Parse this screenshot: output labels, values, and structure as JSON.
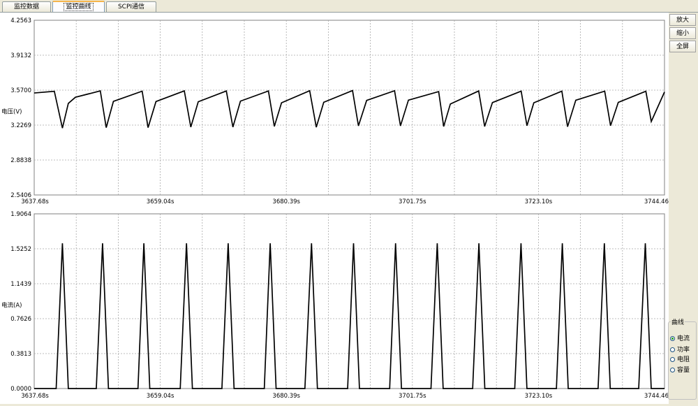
{
  "tabs": [
    {
      "label": "监控数据",
      "active": false
    },
    {
      "label": "监控曲线",
      "active": true
    },
    {
      "label": "SCPI通信",
      "active": false
    }
  ],
  "side_buttons": [
    "放大",
    "缩小",
    "全屏"
  ],
  "curve_group": {
    "title": "曲线",
    "options": [
      {
        "label": "电流",
        "selected": true
      },
      {
        "label": "功率",
        "selected": false
      },
      {
        "label": "电阻",
        "selected": false
      },
      {
        "label": "容量",
        "selected": false
      }
    ]
  },
  "chart_data": [
    {
      "type": "line",
      "ylabel": "电压(V)",
      "xlabel": "",
      "ylim": [
        2.5406,
        4.2563
      ],
      "yticks": [
        "4.2563",
        "3.9132",
        "3.5700",
        "3.2269",
        "2.8838",
        "2.5406"
      ],
      "xlim": [
        3637.68,
        3744.46
      ],
      "xticks": [
        "3637.68s",
        "3659.04s",
        "3680.39s",
        "3701.75s",
        "3723.10s",
        "3744.46"
      ],
      "grid": true,
      "series": [
        {
          "x": [
            3637.68,
            3641.09,
            3642.46,
            3643.46,
            3644.66,
            3648.88,
            3649.88,
            3651.1,
            3655.97,
            3656.97,
            3658.31,
            3663.11,
            3664.21,
            3665.47,
            3670.23,
            3671.34,
            3672.62,
            3677.36,
            3678.36,
            3679.58,
            3684.35,
            3685.47,
            3686.73,
            3691.61,
            3692.61,
            3694.0,
            3698.73,
            3699.73,
            3701.08,
            3706.2,
            3707.05,
            3708.18,
            3712.98,
            3713.99,
            3715.31,
            3720.18,
            3721.16,
            3722.32,
            3727.07,
            3728.04,
            3729.43,
            3734.33,
            3735.32,
            3736.63,
            3741.3,
            3742.22,
            3744.46
          ],
          "y": [
            3.542,
            3.559,
            3.197,
            3.44,
            3.5,
            3.563,
            3.202,
            3.46,
            3.56,
            3.202,
            3.458,
            3.563,
            3.207,
            3.456,
            3.562,
            3.207,
            3.462,
            3.562,
            3.214,
            3.446,
            3.564,
            3.206,
            3.451,
            3.566,
            3.219,
            3.469,
            3.564,
            3.219,
            3.472,
            3.556,
            3.213,
            3.434,
            3.562,
            3.213,
            3.448,
            3.56,
            3.221,
            3.446,
            3.56,
            3.211,
            3.471,
            3.56,
            3.221,
            3.45,
            3.559,
            3.262,
            3.552
          ]
        }
      ]
    },
    {
      "type": "line",
      "ylabel": "电流(A)",
      "xlabel": "",
      "ylim": [
        0.0,
        1.9064
      ],
      "yticks": [
        "1.9064",
        "1.5252",
        "1.1439",
        "0.7626",
        "0.3813",
        "0.0000"
      ],
      "xlim": [
        3637.68,
        3744.46
      ],
      "xticks": [
        "3637.68s",
        "3659.04s",
        "3680.39s",
        "3701.75s",
        "3723.10s",
        "3744.46"
      ],
      "grid": true,
      "series": [
        {
          "x": [
            3637.68,
            3641.4,
            3642.46,
            3643.46,
            3648.2,
            3649.26,
            3650.26,
            3655.26,
            3656.26,
            3657.26,
            3662.42,
            3663.48,
            3664.48,
            3669.48,
            3670.54,
            3671.54,
            3676.66,
            3677.66,
            3678.66,
            3683.54,
            3684.66,
            3685.66,
            3690.78,
            3691.78,
            3692.78,
            3697.9,
            3698.9,
            3699.9,
            3704.9,
            3705.96,
            3706.96,
            3711.96,
            3713.02,
            3714.02,
            3719.09,
            3720.15,
            3721.15,
            3726.15,
            3727.15,
            3728.15,
            3733.21,
            3734.27,
            3735.27,
            3740.09,
            3741.21,
            3742.21,
            3744.46
          ],
          "y": [
            0,
            0,
            1.585,
            0,
            0,
            1.585,
            0,
            0,
            1.585,
            0,
            0,
            1.585,
            0,
            0,
            1.585,
            0,
            0,
            1.585,
            0,
            0,
            1.585,
            0,
            0,
            1.585,
            0,
            0,
            1.585,
            0,
            0,
            1.585,
            0,
            0,
            1.585,
            0,
            0,
            1.585,
            0,
            0,
            1.585,
            0,
            0,
            1.585,
            0,
            0,
            1.585,
            0,
            0
          ]
        }
      ]
    }
  ]
}
